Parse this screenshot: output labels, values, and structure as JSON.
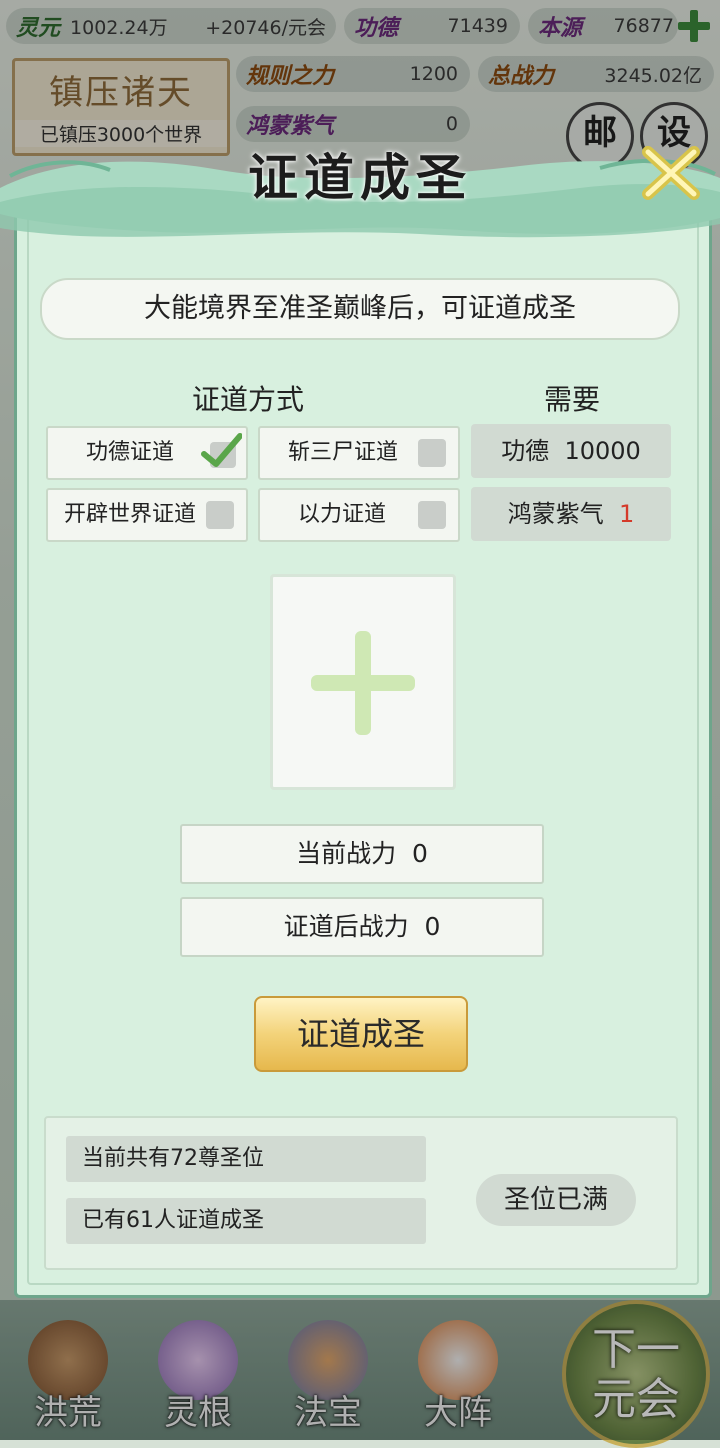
{
  "resources": {
    "lingyuan": {
      "label": "灵元",
      "value": "1002.24万",
      "rate": "+20746/元会"
    },
    "gongde": {
      "label": "功德",
      "value": "71439"
    },
    "benyuan": {
      "label": "本源",
      "value": "76877"
    },
    "guize": {
      "label": "规则之力",
      "value": "1200"
    },
    "zongzhanli": {
      "label": "总战力",
      "value": "3245.02亿"
    },
    "hongmeng": {
      "label": "鸿蒙紫气",
      "value": "0"
    }
  },
  "zhenya": {
    "title": "镇压诸天",
    "subtitle": "已镇压3000个世界"
  },
  "side_buttons": {
    "mail": "邮",
    "settings": "设"
  },
  "modal": {
    "title": "证道成圣",
    "banner": "大能境界至准圣巅峰后，可证道成圣",
    "method_header": "证道方式",
    "need_header": "需要",
    "options": [
      {
        "label": "功德证道",
        "checked": true
      },
      {
        "label": "斩三尸证道",
        "checked": false
      },
      {
        "label": "开辟世界证道",
        "checked": false
      },
      {
        "label": "以力证道",
        "checked": false
      }
    ],
    "needs": {
      "gongde_label": "功德",
      "gongde_value": "10000",
      "hongmeng_label": "鸿蒙紫气",
      "hongmeng_value": "1"
    },
    "current_power": {
      "label": "当前战力",
      "value": "0"
    },
    "after_power": {
      "label": "证道后战力",
      "value": "0"
    },
    "confirm_label": "证道成圣",
    "info": {
      "total_seats": "当前共有72尊圣位",
      "achieved": "已有61人证道成圣",
      "status": "圣位已满"
    }
  },
  "nav": {
    "items": [
      {
        "label": "洪荒"
      },
      {
        "label": "灵根"
      },
      {
        "label": "法宝"
      },
      {
        "label": "大阵"
      }
    ],
    "next_line1": "下一",
    "next_line2": "元会"
  },
  "colors": {
    "modal_bg": "#d8f0df",
    "check_green": "#5aa64a",
    "red_value": "#d43a2a",
    "gold_button": "#f3d37a"
  }
}
